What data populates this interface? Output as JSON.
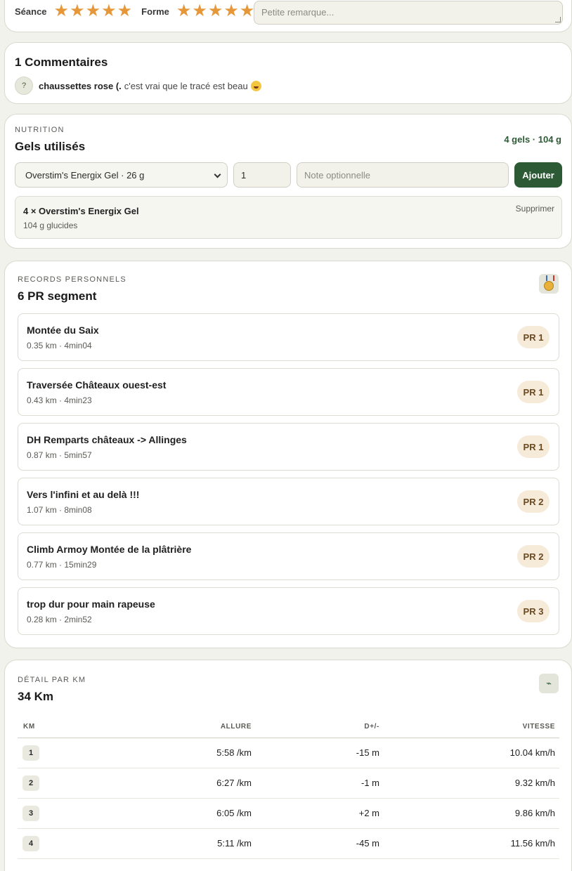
{
  "rating": {
    "seance_label": "Séance",
    "forme_label": "Forme",
    "seance_stars": 5,
    "forme_stars": 5,
    "star_glyph": "★",
    "remark_placeholder": "Petite remarque..."
  },
  "comments": {
    "title": "1 Commentaires",
    "items": [
      {
        "avatar": "?",
        "author": "chaussettes rose (.",
        "text": "c'est vrai que le tracé est beau",
        "emoji": "grinning-squint-face"
      }
    ]
  },
  "nutrition": {
    "kicker": "NUTRITION",
    "title": "Gels utilisés",
    "summary": "4 gels · 104 g",
    "select_value": "Overstim's Energix Gel · 26 g",
    "quantity_value": "1",
    "note_placeholder": "Note optionnelle",
    "add_label": "Ajouter",
    "entries": [
      {
        "name": "4 × Overstim's Energix Gel",
        "carbs": "104 g glucides",
        "delete_label": "Supprimer"
      }
    ]
  },
  "records": {
    "kicker": "RECORDS PERSONNELS",
    "title": "6 PR segment",
    "icon": "medal-icon",
    "items": [
      {
        "name": "Montée du Saix",
        "meta": "0.35 km · 4min04",
        "badge": "PR 1"
      },
      {
        "name": "Traversée Châteaux ouest-est",
        "meta": "0.43 km · 4min23",
        "badge": "PR 1"
      },
      {
        "name": "DH Remparts châteaux -> Allinges",
        "meta": "0.87 km · 5min57",
        "badge": "PR 1"
      },
      {
        "name": "Vers l'infini et au delà !!!",
        "meta": "1.07 km · 8min08",
        "badge": "PR 2"
      },
      {
        "name": "Climb Armoy Montée de la plâtrière",
        "meta": "0.77 km · 15min29",
        "badge": "PR 2"
      },
      {
        "name": "trop dur pour main rapeuse",
        "meta": "0.28 km · 2min52",
        "badge": "PR 3"
      }
    ]
  },
  "km_detail": {
    "kicker": "DÉTAIL PAR KM",
    "title": "34 Km",
    "icon": "bolt-icon",
    "headers": {
      "km": "KM",
      "pace": "ALLURE",
      "elevation": "D+/-",
      "speed": "VITESSE"
    },
    "rows": [
      {
        "km": "1",
        "pace": "5:58 /km",
        "elevation": "-15 m",
        "speed": "10.04 km/h"
      },
      {
        "km": "2",
        "pace": "6:27 /km",
        "elevation": "-1 m",
        "speed": "9.32 km/h"
      },
      {
        "km": "3",
        "pace": "6:05 /km",
        "elevation": "+2 m",
        "speed": "9.86 km/h"
      },
      {
        "km": "4",
        "pace": "5:11 /km",
        "elevation": "-45 m",
        "speed": "11.56 km/h"
      }
    ]
  },
  "colors": {
    "accent_green": "#2c5a35",
    "star_orange": "#e6973a",
    "badge_bg": "#f6ead9",
    "page_bg": "#f2f2ec"
  }
}
